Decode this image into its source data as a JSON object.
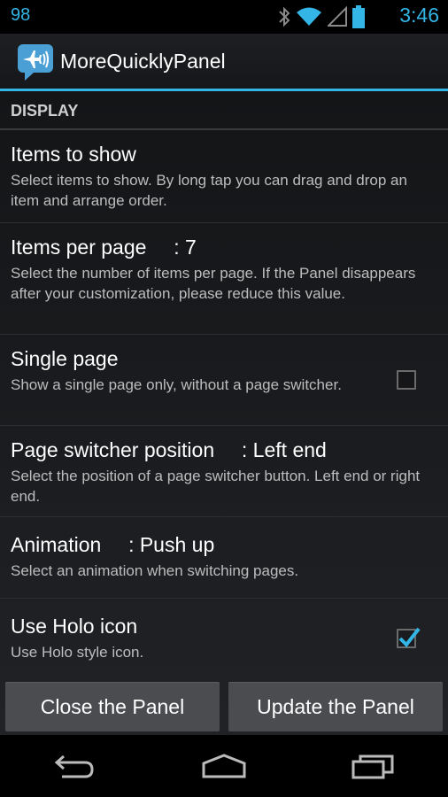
{
  "status_bar": {
    "notification_count": "98",
    "time": "3:46"
  },
  "app": {
    "title": "MoreQuicklyPanel"
  },
  "section": {
    "header": "DISPLAY"
  },
  "prefs": {
    "items_to_show": {
      "title": "Items to show",
      "summary": "Select items to show. By long tap you can drag and drop an item and arrange order."
    },
    "items_per_page": {
      "title": "Items per page",
      "value": ":  7",
      "summary": "Select the number of items per page. If the Panel disappears after your customization, please reduce this value."
    },
    "single_page": {
      "title": "Single page",
      "summary": "Show a single page only, without a page switcher.",
      "checked": false
    },
    "page_switcher_position": {
      "title": "Page switcher position",
      "value": ":  Left end",
      "summary": "Select the position of a page switcher button. Left end or right end."
    },
    "animation": {
      "title": "Animation",
      "value": ":  Push up",
      "summary": "Select an animation when switching pages."
    },
    "use_holo_icon": {
      "title": "Use Holo icon",
      "summary": "Use Holo style icon.",
      "checked": true
    }
  },
  "buttons": {
    "close": "Close the Panel",
    "update": "Update the Panel"
  },
  "icons": {
    "status": [
      "bluetooth-icon",
      "wifi-icon",
      "signal-icon",
      "battery-icon"
    ],
    "nav": [
      "back-icon",
      "home-icon",
      "recents-icon"
    ]
  },
  "colors": {
    "accent": "#33b5e5",
    "background": "#1a1b1e",
    "button": "#4a4c50"
  }
}
